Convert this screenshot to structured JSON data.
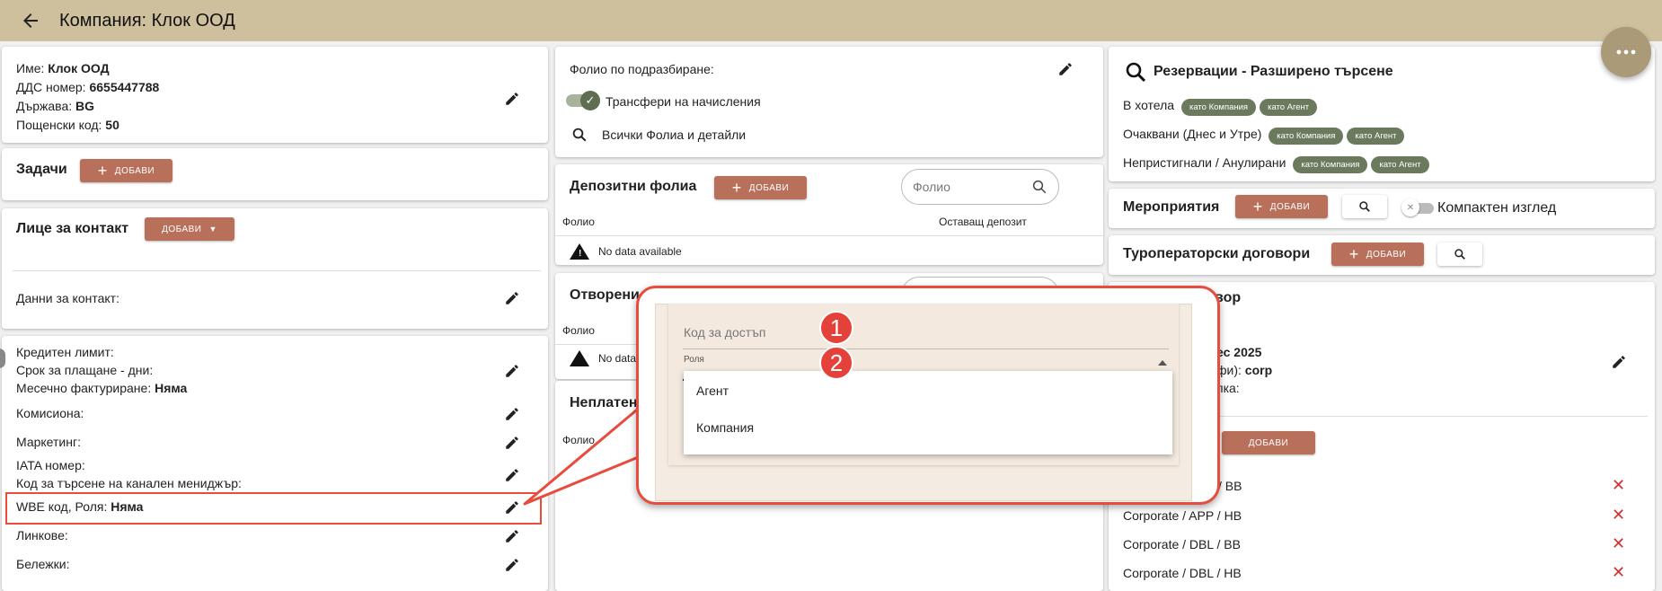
{
  "header": {
    "title": "Компания: Клок ООД"
  },
  "company_card": {
    "name_label": "Име:",
    "name_value": "Клок ООД",
    "vat_label": "ДДС номер:",
    "vat_value": "6655447788",
    "country_label": "Държава:",
    "country_value": "BG",
    "postal_label": "Пощенски код:",
    "postal_value": "50"
  },
  "tasks_card": {
    "title": "Задачи",
    "add_label": "ДОБАВИ"
  },
  "contact_card": {
    "title": "Лице за контакт",
    "add_label": "ДОБАВИ",
    "contact_data_label": "Данни за контакт:"
  },
  "details_card": {
    "credit_limit_label": "Кредитен лимит:",
    "payment_term_label": "Срок за плащане - дни:",
    "monthly_invoicing_label": "Месечно фактуриране:",
    "monthly_invoicing_value": "Няма",
    "commission_label": "Комисиона:",
    "marketing_label": "Маркетинг:",
    "iata_label": "IATA номер:",
    "channel_manager_label": "Код за търсене на канален мениджър:",
    "wbe_label": "WBE код, Роля:",
    "wbe_value": "Няма",
    "links_label": "Линкове:",
    "notes_label": "Бележки:"
  },
  "folio_card": {
    "default_folio_label": "Фолио по подразбиране:",
    "transfer_label": "Трансфери на начисления",
    "all_folios_label": "Всички Фолиа и детайли"
  },
  "deposit_card": {
    "title": "Депозитни фолиа",
    "add_label": "ДОБАВИ",
    "search_placeholder": "Фолио",
    "col_folio": "Фолио",
    "col_remaining": "Оставащ депозит",
    "empty_text": "No data available"
  },
  "open_card": {
    "title": "Отворени",
    "col_folio": "Фолио",
    "empty_text": "No data"
  },
  "unpaid_card": {
    "title": "Неплатен",
    "col_folio": "Фолио"
  },
  "reservations_card": {
    "title": "Резервации - Разширено търсене",
    "in_hotel_label": "В хотела",
    "expected_label": "Очаквани (Днес и Утре)",
    "noshow_label": "Непристигнали / Анулирани",
    "chip_company": "като Компания",
    "chip_agent": "като Агент"
  },
  "events_card": {
    "title": "Мероприятия",
    "add_label": "ДОБАВИ",
    "compact_label": "Компактен изглед"
  },
  "tour_card": {
    "title": "Туроператорски договори",
    "add_label": "ДОБАВИ"
  },
  "contract_card": {
    "title_partial": "вор",
    "date_partial": "ес 2025",
    "tariff_partial": "фи):",
    "tariff_value": "corp",
    "extra_partial": "пка:",
    "add_label": "ДОБАВИ",
    "rates": [
      "/ BB",
      "Corporate / APP / HB",
      "Corporate / DBL / BB",
      "Corporate / DBL / HB"
    ]
  },
  "popup": {
    "access_code_placeholder": "Код за достъп",
    "role_label": "Роля",
    "options": [
      "Агент",
      "Компания"
    ],
    "badge_1": "1",
    "badge_2": "2"
  },
  "colors": {
    "header_bg": "#cec09d",
    "add_button": "#b8705a",
    "chip": "#6b7a5c",
    "annotation": "#e74c3c"
  }
}
